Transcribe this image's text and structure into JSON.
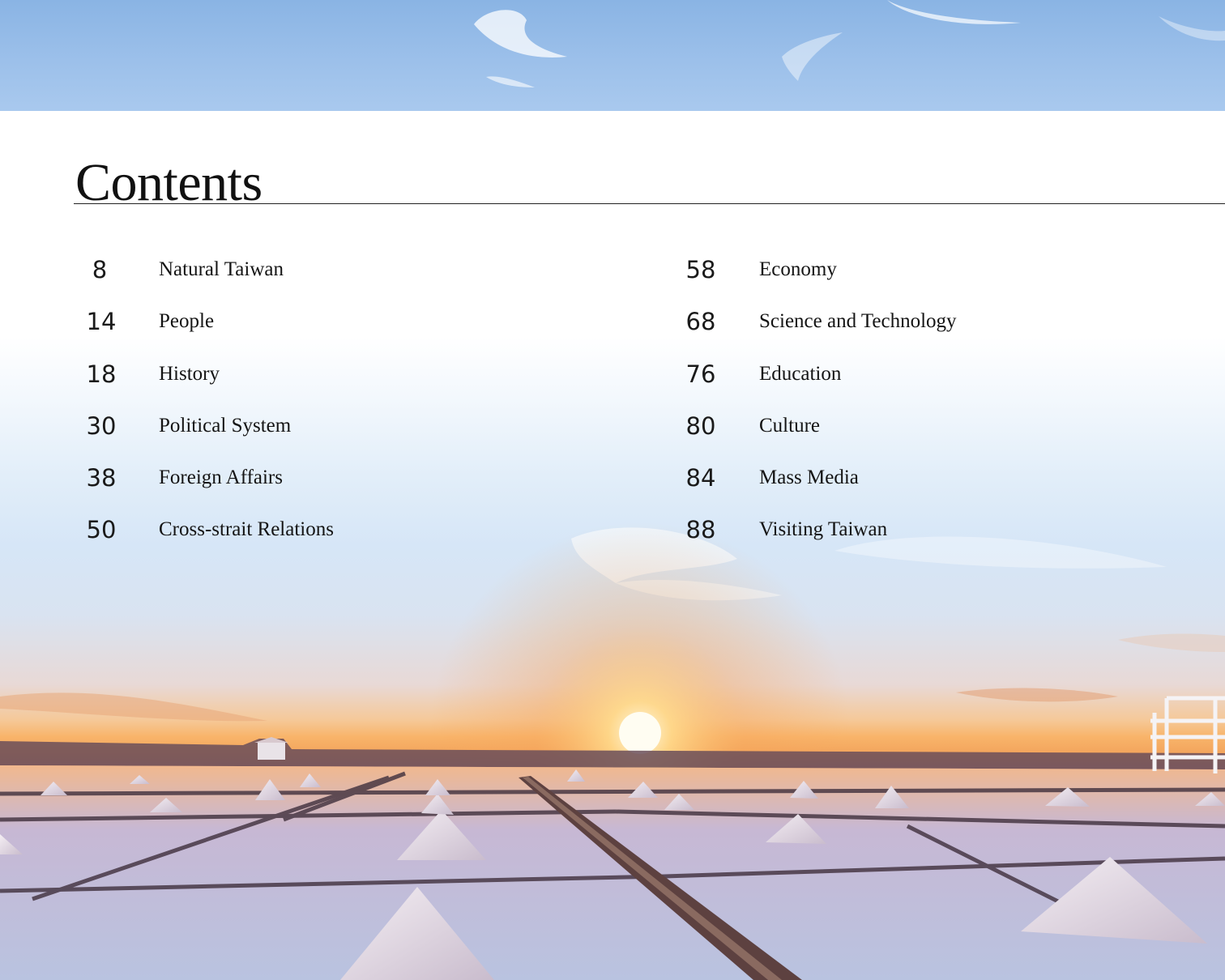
{
  "title": "Contents",
  "colors": {
    "text": "#141414",
    "rule": "#222222",
    "sky": "#9cc0ea",
    "sunset": "#f8b46a"
  },
  "toc": {
    "left": [
      {
        "page": "8",
        "label": "Natural Taiwan"
      },
      {
        "page": "14",
        "label": "People"
      },
      {
        "page": "18",
        "label": "History"
      },
      {
        "page": "30",
        "label": "Political System"
      },
      {
        "page": "38",
        "label": "Foreign Affairs"
      },
      {
        "page": "50",
        "label": "Cross-strait Relations"
      }
    ],
    "right": [
      {
        "page": "58",
        "label": "Economy"
      },
      {
        "page": "68",
        "label": "Science and Technology"
      },
      {
        "page": "76",
        "label": "Education"
      },
      {
        "page": "80",
        "label": "Culture"
      },
      {
        "page": "84",
        "label": "Mass Media"
      },
      {
        "page": "88",
        "label": "Visiting Taiwan"
      }
    ]
  }
}
